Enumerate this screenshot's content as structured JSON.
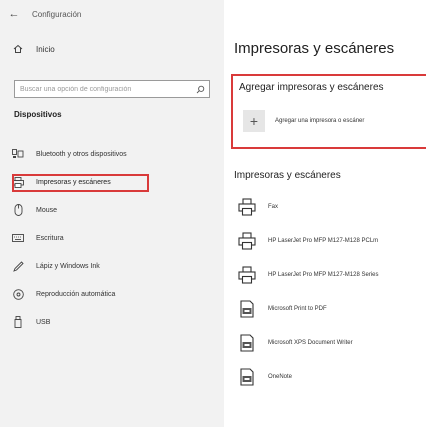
{
  "sidebar": {
    "app_title": "Configuración",
    "home_label": "Inicio",
    "search_placeholder": "Buscar una opción de configuración",
    "section_label": "Dispositivos",
    "items": [
      {
        "label": "Bluetooth y otros dispositivos",
        "icon": "bluetooth-icon"
      },
      {
        "label": "Impresoras y escáneres",
        "icon": "printer-icon",
        "active": true
      },
      {
        "label": "Mouse",
        "icon": "mouse-icon"
      },
      {
        "label": "Escritura",
        "icon": "keyboard-icon"
      },
      {
        "label": "Lápiz y Windows Ink",
        "icon": "pen-icon"
      },
      {
        "label": "Reproducción automática",
        "icon": "autoplay-icon"
      },
      {
        "label": "USB",
        "icon": "usb-icon"
      }
    ]
  },
  "main": {
    "title": "Impresoras y escáneres",
    "add_section": {
      "heading": "Agregar impresoras y escáneres",
      "button_label": "Agregar una impresora o escáner"
    },
    "list_heading": "Impresoras y escáneres",
    "printers": [
      {
        "name": "Fax",
        "icon": "fax-printer-icon"
      },
      {
        "name": "HP LaserJet Pro MFP M127-M128 PCLm",
        "icon": "printer-icon"
      },
      {
        "name": "HP LaserJet Pro MFP M127-M128 Series",
        "icon": "printer-icon"
      },
      {
        "name": "Microsoft Print to PDF",
        "icon": "pdf-printer-icon"
      },
      {
        "name": "Microsoft XPS Document Writer",
        "icon": "xps-printer-icon"
      },
      {
        "name": "OneNote",
        "icon": "onenote-printer-icon"
      }
    ]
  },
  "colors": {
    "sidebar_bg": "#f2f2f2",
    "highlight": "#d93a3a"
  }
}
